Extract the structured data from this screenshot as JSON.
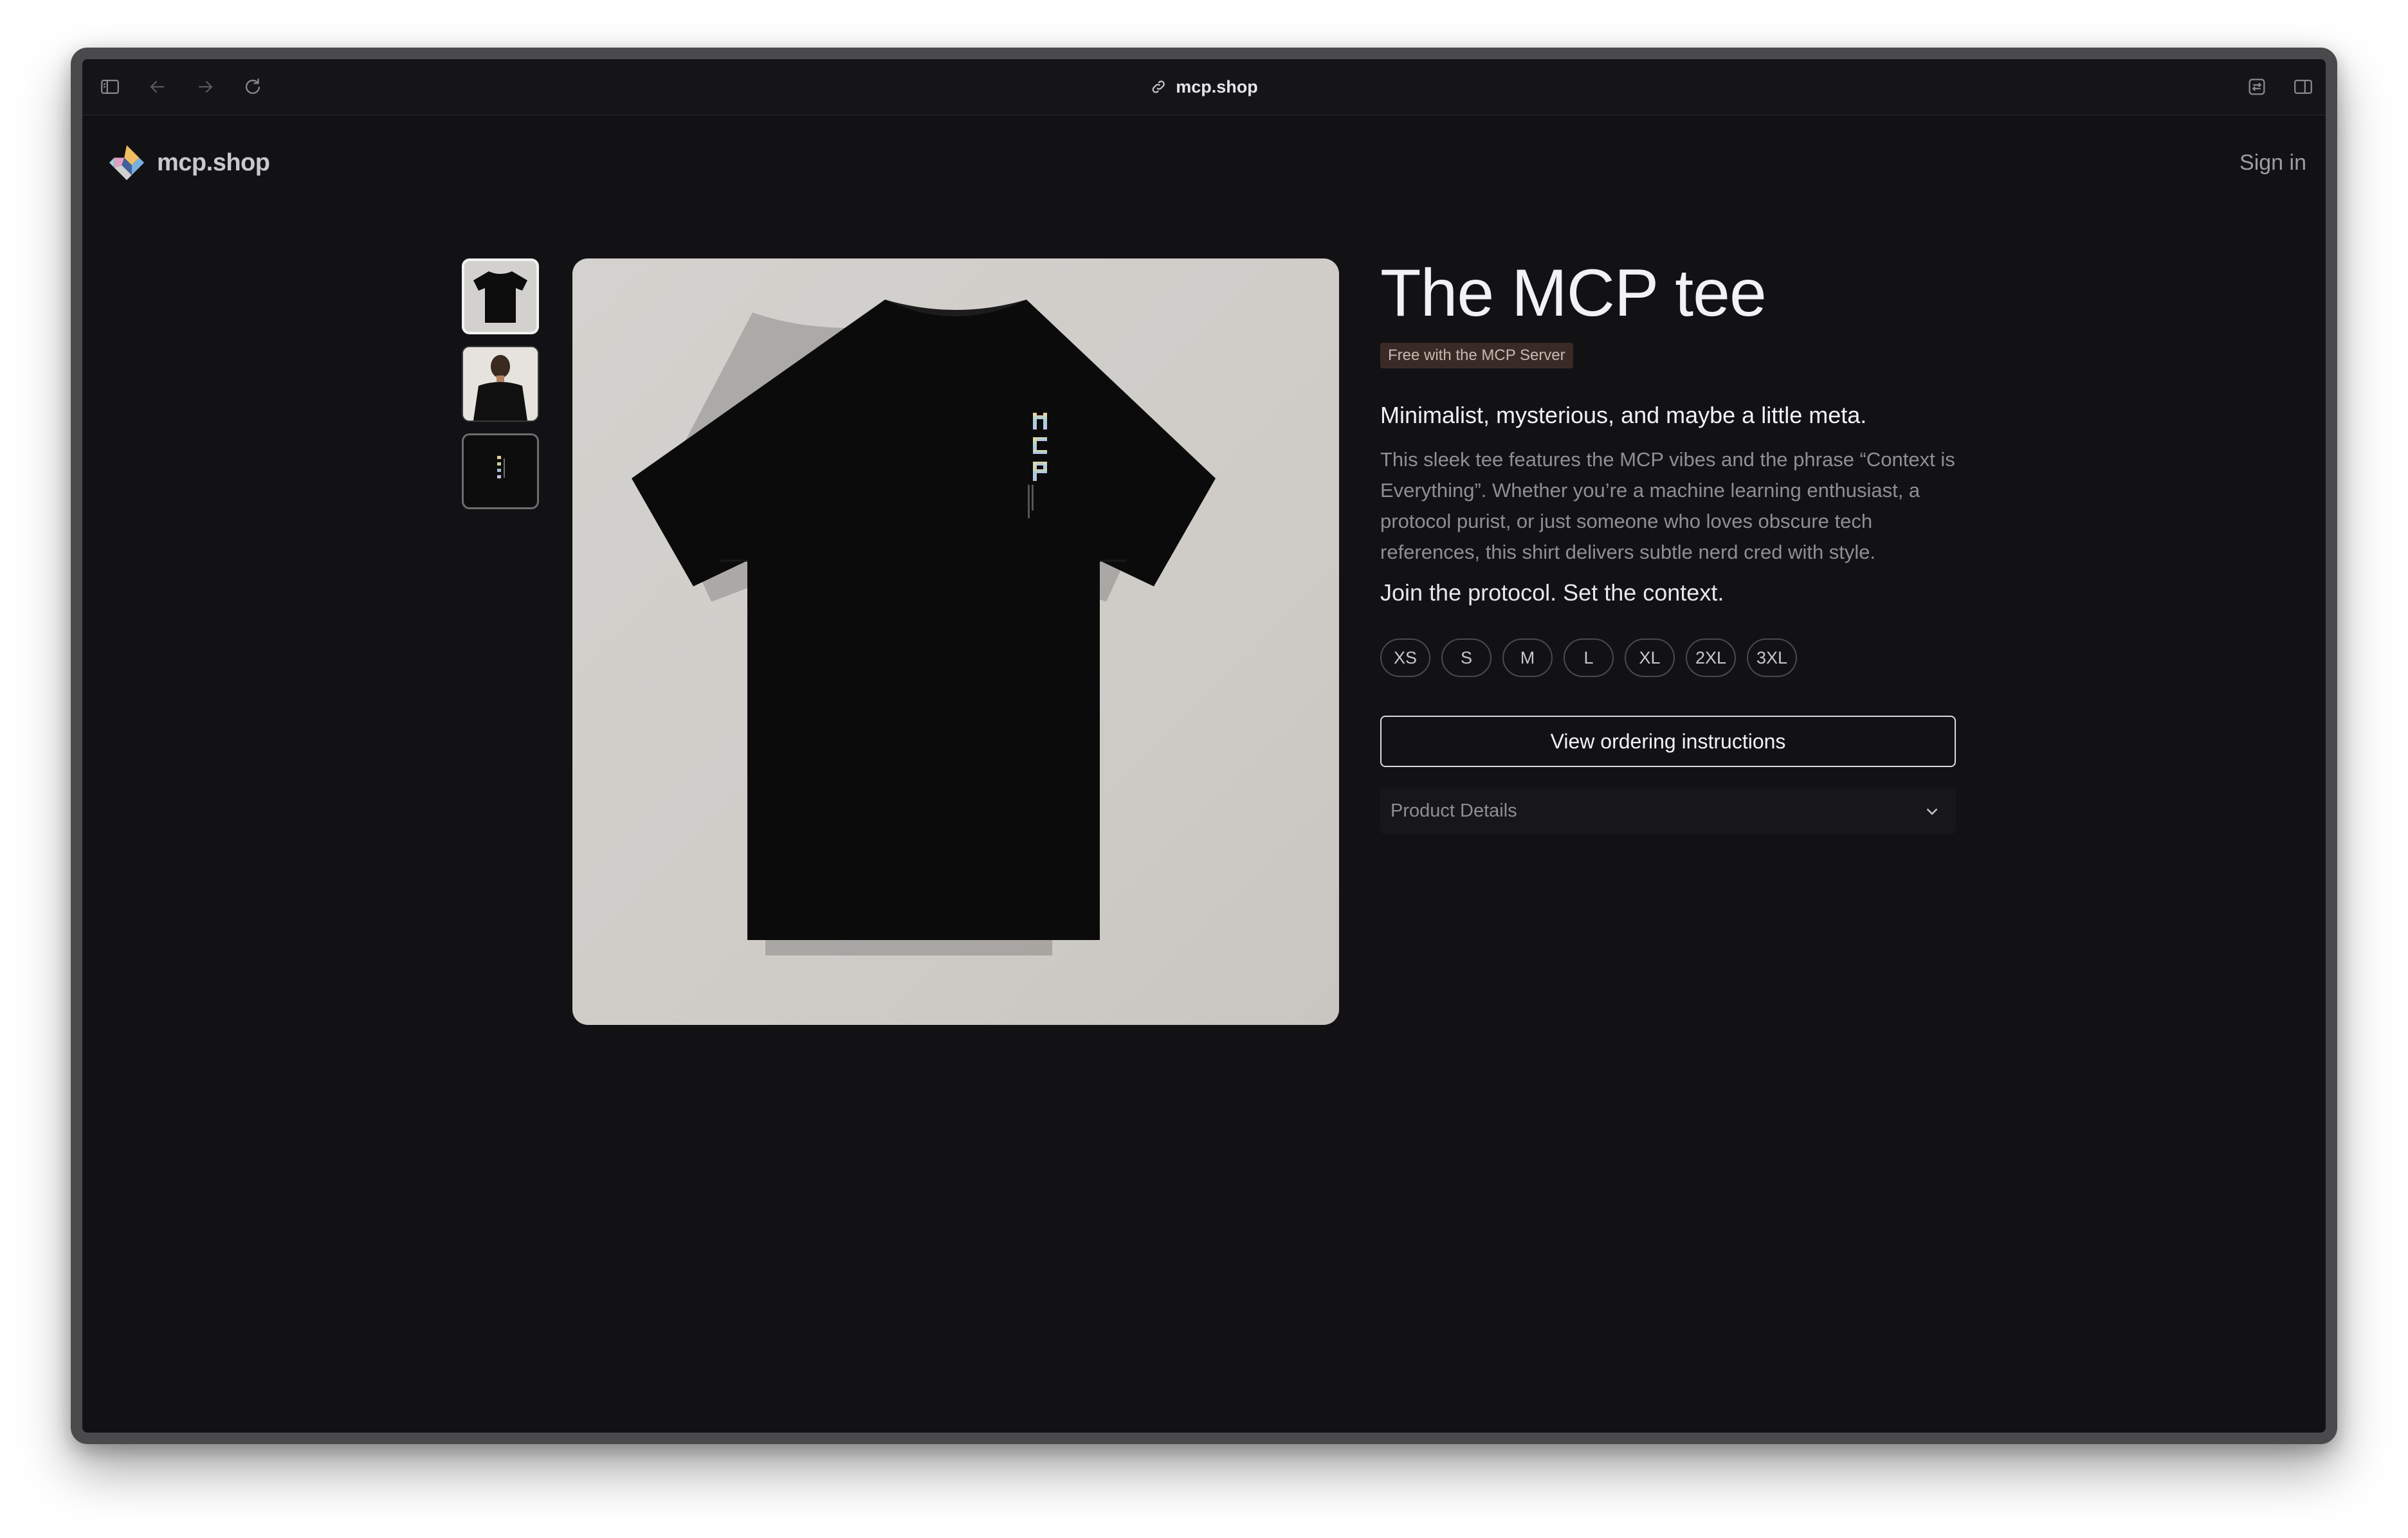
{
  "browser": {
    "url": "mcp.shop",
    "icons": [
      "sidebar-icon",
      "back-arrow-icon",
      "forward-arrow-icon",
      "reload-icon",
      "link-icon",
      "translate-icon",
      "split-view-icon"
    ]
  },
  "site": {
    "logo_text": "mcp.shop",
    "sign_in": "Sign in"
  },
  "product": {
    "title": "The MCP tee",
    "badge": "Free with the MCP Server",
    "tagline": "Minimalist, mysterious, and maybe a little meta.",
    "description": "This sleek tee features the MCP vibes and the phrase “Context is Everything”. Whether you’re a machine learning enthusiast, a protocol purist, or just someone who loves obscure tech references, this shirt delivers subtle nerd cred with style.",
    "closing": "Join the protocol. Set the context.",
    "sizes": [
      "XS",
      "S",
      "M",
      "L",
      "XL",
      "2XL",
      "3XL"
    ],
    "order_button": "View ordering instructions",
    "details_label": "Product Details",
    "shirt_print": "MCP"
  },
  "colors": {
    "background": "#121214",
    "badge_bg": "#3a2a26",
    "image_bg": "#d4d2ce"
  }
}
